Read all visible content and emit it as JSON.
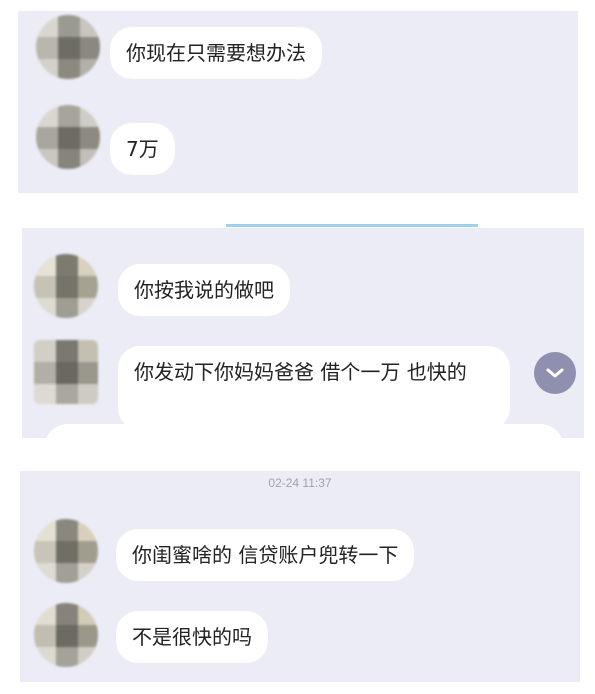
{
  "chat": {
    "panel_1": {
      "messages": [
        {
          "text": "你现在只需要想办法"
        },
        {
          "text": "7万"
        }
      ]
    },
    "panel_2": {
      "messages": [
        {
          "text": "你按我说的做吧"
        },
        {
          "text": "你发动下你妈妈爸爸 借个一万 也快的"
        }
      ]
    },
    "panel_3": {
      "timestamp": "02-24 11:37",
      "messages": [
        {
          "text": "你闺蜜啥的 信贷账户兜转一下"
        },
        {
          "text": "不是很快的吗"
        }
      ]
    }
  },
  "controls": {
    "scroll_down_icon": "chevron-down-icon"
  },
  "colors": {
    "panel_bg": "#ebecf6",
    "bubble_bg": "#ffffff",
    "scroll_button": "#8f8fb0",
    "divider": "#9fd2ea"
  }
}
